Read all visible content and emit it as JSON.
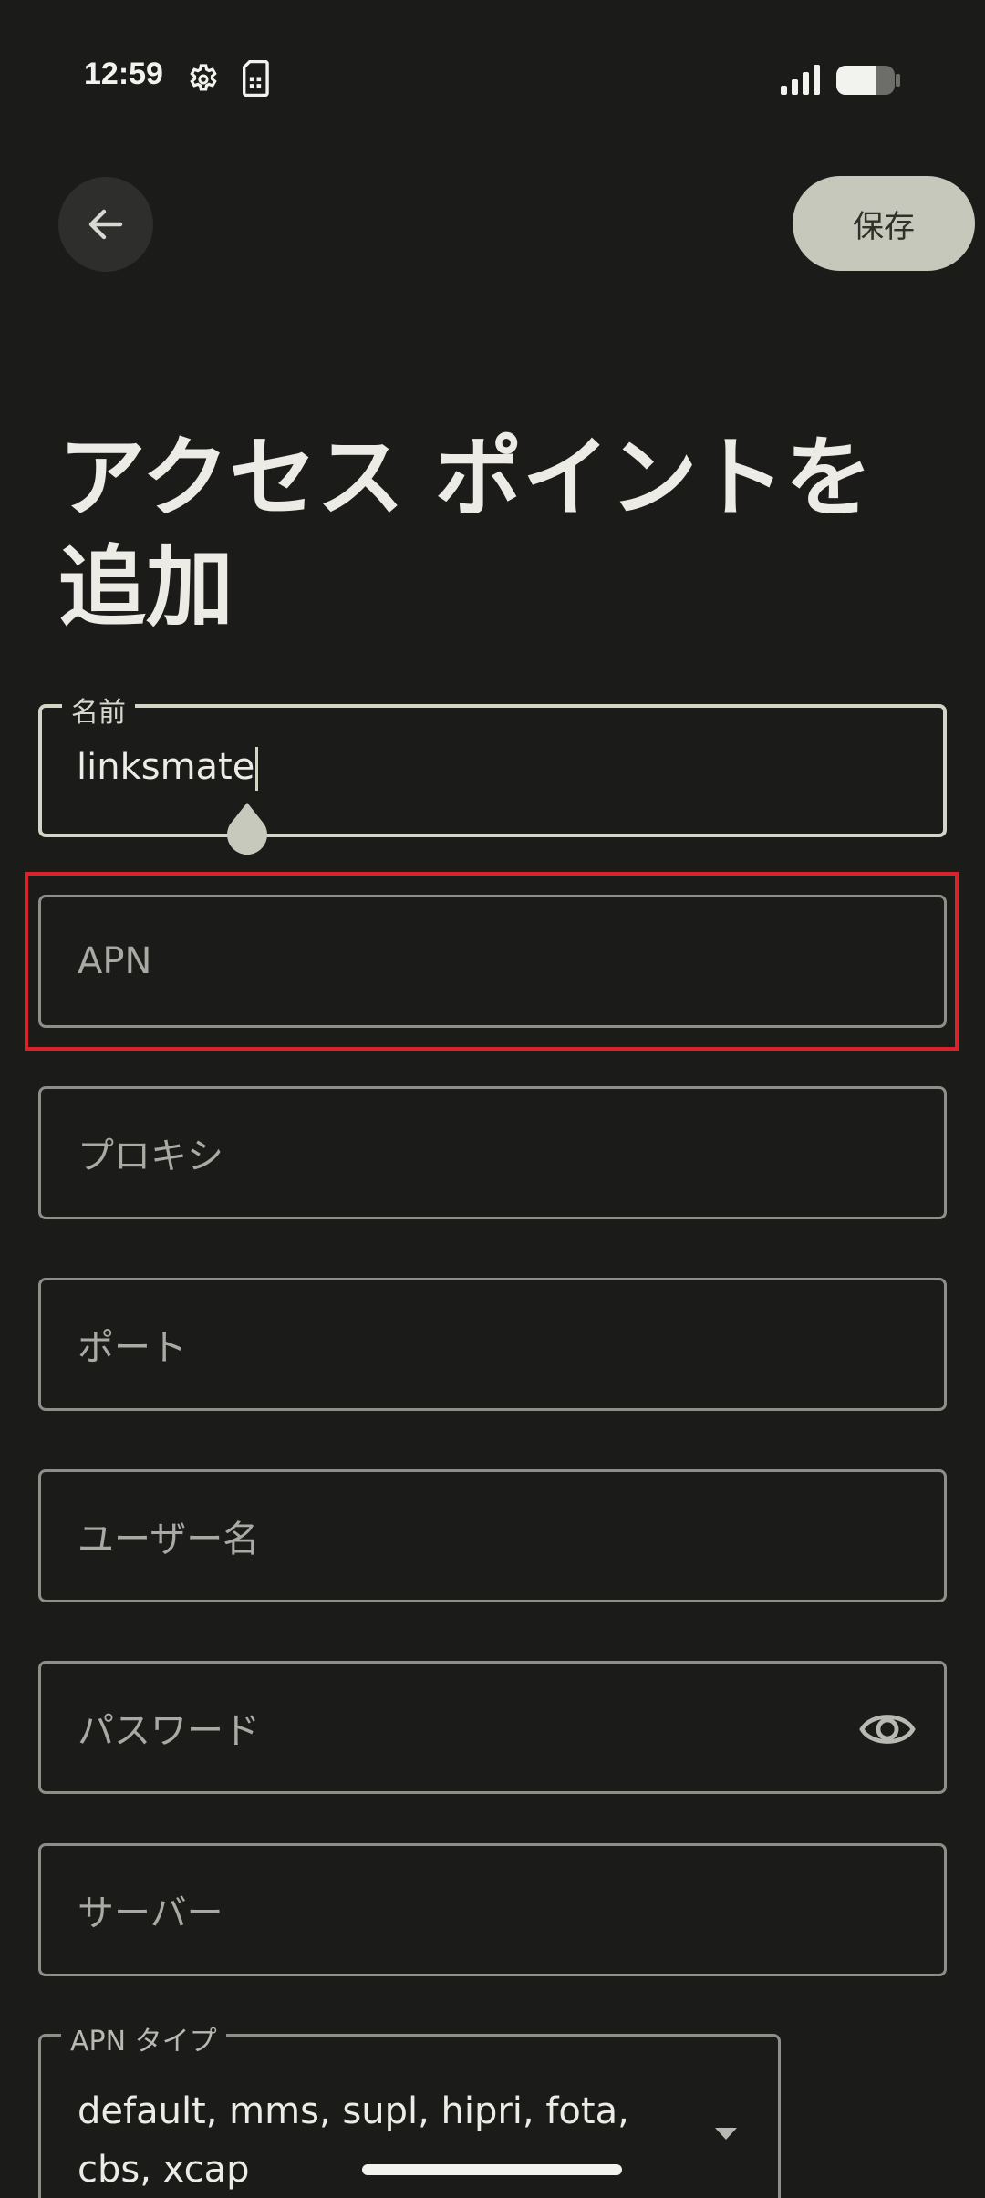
{
  "status_bar": {
    "time": "12:59"
  },
  "toolbar": {
    "back_icon": "arrow-back-icon",
    "save_label": "保存"
  },
  "page": {
    "title": "アクセス ポイントを追加"
  },
  "form": {
    "name": {
      "label": "名前",
      "value": "linksmate"
    },
    "apn": {
      "placeholder": "APN"
    },
    "proxy": {
      "placeholder": "プロキシ"
    },
    "port": {
      "placeholder": "ポート"
    },
    "username": {
      "placeholder": "ユーザー名"
    },
    "password": {
      "placeholder": "パスワード",
      "toggle_icon": "eye-icon"
    },
    "server": {
      "placeholder": "サーバー"
    },
    "apn_type": {
      "label": "APN タイプ",
      "value": "default, mms, supl, hipri, fota, cbs, xcap"
    }
  },
  "colors": {
    "background": "#1b1b1a",
    "save_button_bg": "#c6c8bc",
    "focus_border": "#d3d5c9",
    "highlight": "#d8232a"
  }
}
